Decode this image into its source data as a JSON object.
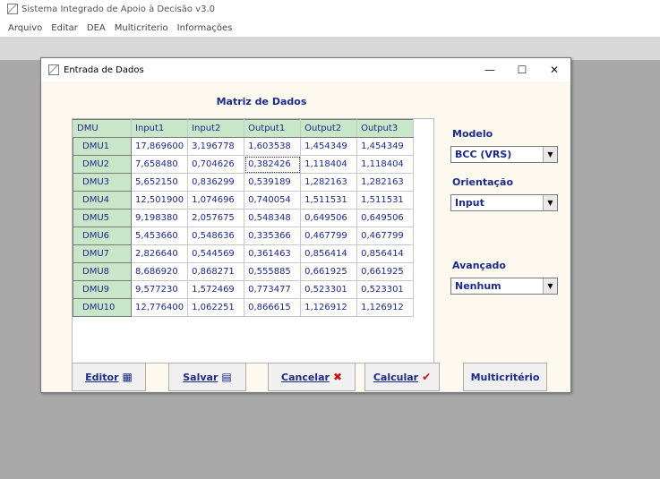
{
  "app": {
    "title": "Sistema Integrado de Apoio à Decisão v3.0",
    "menu": [
      "Arquivo",
      "Editar",
      "DEA",
      "Multicriterio",
      "Informações"
    ]
  },
  "dialog": {
    "title": "Entrada de Dados",
    "controls": {
      "minimize": "—",
      "maximize": "☐",
      "close": "✕"
    },
    "matrix_title": "Matriz de Dados",
    "table": {
      "columns": [
        "DMU",
        "Input1",
        "Input2",
        "Output1",
        "Output2",
        "Output3"
      ],
      "rows": [
        [
          "DMU1",
          "17,869600",
          "3,196778",
          "1,603538",
          "1,454349",
          "1,454349"
        ],
        [
          "DMU2",
          "7,658480",
          "0,704626",
          "0,382426",
          "1,118404",
          "1,118404"
        ],
        [
          "DMU3",
          "5,652150",
          "0,836299",
          "0,539189",
          "1,282163",
          "1,282163"
        ],
        [
          "DMU4",
          "12,501900",
          "1,074696",
          "0,740054",
          "1,511531",
          "1,511531"
        ],
        [
          "DMU5",
          "9,198380",
          "2,057675",
          "0,548348",
          "0,649506",
          "0,649506"
        ],
        [
          "DMU6",
          "5,453660",
          "0,548636",
          "0,335366",
          "0,467799",
          "0,467799"
        ],
        [
          "DMU7",
          "2,826640",
          "0,544569",
          "0,361463",
          "0,856414",
          "0,856414"
        ],
        [
          "DMU8",
          "8,686920",
          "0,868271",
          "0,555885",
          "0,661925",
          "0,661925"
        ],
        [
          "DMU9",
          "9,577230",
          "1,572469",
          "0,773477",
          "0,523301",
          "0,523301"
        ],
        [
          "DMU10",
          "12,776400",
          "1,062251",
          "0,866615",
          "1,126912",
          "1,126912"
        ]
      ]
    },
    "side": {
      "modelo_label": "Modelo",
      "modelo_value": "BCC (VRS)",
      "orientacao_label": "Orientação",
      "orientacao_value": "Input",
      "avancado_label": "Avançado",
      "avancado_value": "Nenhum"
    },
    "buttons": {
      "editor": "Editor",
      "salvar": "Salvar",
      "cancelar": "Cancelar",
      "calcular": "Calcular",
      "multicriterio": "Multicritério"
    }
  },
  "colors": {
    "label_blue": "#1c2a8a",
    "header_green": "#c8e6c8",
    "client_bg": "#fdf9ee",
    "cancel_red": "#d01010",
    "check_red": "#d01010"
  }
}
